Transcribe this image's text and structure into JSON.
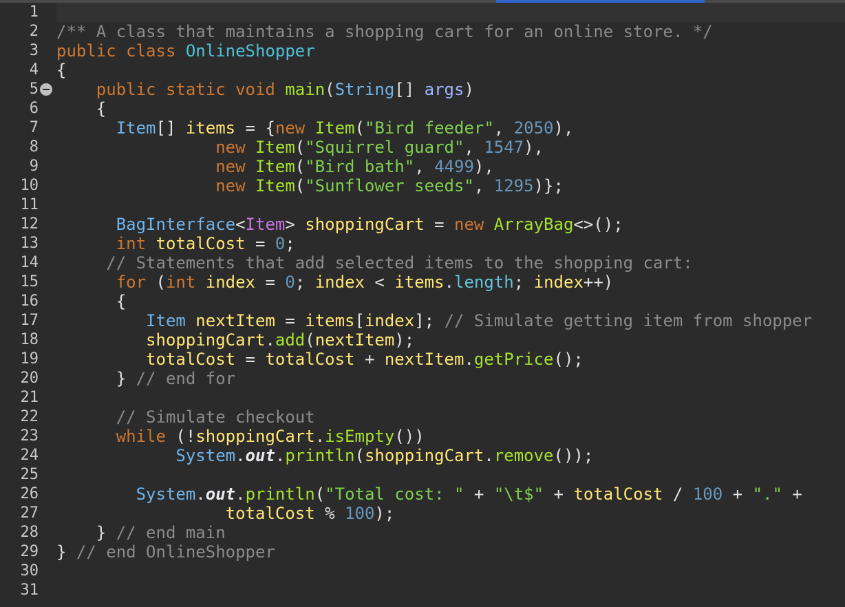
{
  "editor": {
    "line_numbers": [
      "1",
      "2",
      "3",
      "4",
      "5",
      "6",
      "7",
      "8",
      "9",
      "10",
      "11",
      "12",
      "13",
      "14",
      "15",
      "16",
      "17",
      "18",
      "19",
      "20",
      "21",
      "22",
      "23",
      "24",
      "25",
      "26",
      "27",
      "28",
      "29",
      "30",
      "31"
    ],
    "lines": [
      [],
      [
        {
          "t": "/** A class that maintains a shopping cart for an online store. */",
          "c": "cmt"
        }
      ],
      [
        {
          "t": "public class ",
          "c": "kw"
        },
        {
          "t": "OnlineShopper",
          "c": "cls"
        }
      ],
      [
        {
          "t": "{",
          "c": "plain"
        }
      ],
      [
        {
          "t": "    public static void ",
          "c": "kw"
        },
        {
          "t": "main",
          "c": "method"
        },
        {
          "t": "(",
          "c": "plain"
        },
        {
          "t": "String",
          "c": "type"
        },
        {
          "t": "[] ",
          "c": "plain"
        },
        {
          "t": "args",
          "c": "param"
        },
        {
          "t": ")",
          "c": "plain"
        }
      ],
      [
        {
          "t": "    {",
          "c": "plain"
        }
      ],
      [
        {
          "t": "      ",
          "c": "plain"
        },
        {
          "t": "Item",
          "c": "type"
        },
        {
          "t": "[] ",
          "c": "plain"
        },
        {
          "t": "items",
          "c": "var"
        },
        {
          "t": " = {",
          "c": "plain"
        },
        {
          "t": "new ",
          "c": "kw"
        },
        {
          "t": "Item",
          "c": "method"
        },
        {
          "t": "(",
          "c": "plain"
        },
        {
          "t": "\"Bird feeder\"",
          "c": "str"
        },
        {
          "t": ", ",
          "c": "plain"
        },
        {
          "t": "2050",
          "c": "num"
        },
        {
          "t": "),",
          "c": "plain"
        }
      ],
      [
        {
          "t": "                ",
          "c": "plain"
        },
        {
          "t": "new ",
          "c": "kw"
        },
        {
          "t": "Item",
          "c": "method"
        },
        {
          "t": "(",
          "c": "plain"
        },
        {
          "t": "\"Squirrel guard\"",
          "c": "str"
        },
        {
          "t": ", ",
          "c": "plain"
        },
        {
          "t": "1547",
          "c": "num"
        },
        {
          "t": "),",
          "c": "plain"
        }
      ],
      [
        {
          "t": "                ",
          "c": "plain"
        },
        {
          "t": "new ",
          "c": "kw"
        },
        {
          "t": "Item",
          "c": "method"
        },
        {
          "t": "(",
          "c": "plain"
        },
        {
          "t": "\"Bird bath\"",
          "c": "str"
        },
        {
          "t": ", ",
          "c": "plain"
        },
        {
          "t": "4499",
          "c": "num"
        },
        {
          "t": "),",
          "c": "plain"
        }
      ],
      [
        {
          "t": "                ",
          "c": "plain"
        },
        {
          "t": "new ",
          "c": "kw"
        },
        {
          "t": "Item",
          "c": "method"
        },
        {
          "t": "(",
          "c": "plain"
        },
        {
          "t": "\"Sunflower seeds\"",
          "c": "str"
        },
        {
          "t": ", ",
          "c": "plain"
        },
        {
          "t": "1295",
          "c": "num"
        },
        {
          "t": ")};",
          "c": "plain"
        }
      ],
      [],
      [
        {
          "t": "      ",
          "c": "plain"
        },
        {
          "t": "BagInterface",
          "c": "type"
        },
        {
          "t": "<",
          "c": "plain"
        },
        {
          "t": "Item",
          "c": "generic"
        },
        {
          "t": "> ",
          "c": "plain"
        },
        {
          "t": "shoppingCart",
          "c": "var"
        },
        {
          "t": " = ",
          "c": "plain"
        },
        {
          "t": "new ",
          "c": "kw"
        },
        {
          "t": "ArrayBag",
          "c": "method"
        },
        {
          "t": "<>();",
          "c": "plain"
        }
      ],
      [
        {
          "t": "      ",
          "c": "plain"
        },
        {
          "t": "int ",
          "c": "kw"
        },
        {
          "t": "totalCost",
          "c": "var"
        },
        {
          "t": " = ",
          "c": "plain"
        },
        {
          "t": "0",
          "c": "num"
        },
        {
          "t": ";",
          "c": "plain"
        }
      ],
      [
        {
          "t": "     // Statements that add selected items to the shopping cart:",
          "c": "cmt"
        }
      ],
      [
        {
          "t": "      ",
          "c": "plain"
        },
        {
          "t": "for ",
          "c": "kw"
        },
        {
          "t": "(",
          "c": "plain"
        },
        {
          "t": "int ",
          "c": "kw"
        },
        {
          "t": "index",
          "c": "var"
        },
        {
          "t": " = ",
          "c": "plain"
        },
        {
          "t": "0",
          "c": "num"
        },
        {
          "t": "; ",
          "c": "plain"
        },
        {
          "t": "index",
          "c": "var"
        },
        {
          "t": " < ",
          "c": "plain"
        },
        {
          "t": "items",
          "c": "var"
        },
        {
          "t": ".",
          "c": "plain"
        },
        {
          "t": "length",
          "c": "field"
        },
        {
          "t": "; ",
          "c": "plain"
        },
        {
          "t": "index",
          "c": "var"
        },
        {
          "t": "++)",
          "c": "plain"
        }
      ],
      [
        {
          "t": "      {",
          "c": "plain"
        }
      ],
      [
        {
          "t": "         ",
          "c": "plain"
        },
        {
          "t": "Item",
          "c": "type"
        },
        {
          "t": " ",
          "c": "plain"
        },
        {
          "t": "nextItem",
          "c": "var"
        },
        {
          "t": " = ",
          "c": "plain"
        },
        {
          "t": "items",
          "c": "var"
        },
        {
          "t": "[",
          "c": "plain"
        },
        {
          "t": "index",
          "c": "var"
        },
        {
          "t": "]; ",
          "c": "plain"
        },
        {
          "t": "// Simulate getting item from shopper",
          "c": "cmt"
        }
      ],
      [
        {
          "t": "         ",
          "c": "plain"
        },
        {
          "t": "shoppingCart",
          "c": "var"
        },
        {
          "t": ".",
          "c": "plain"
        },
        {
          "t": "add",
          "c": "method"
        },
        {
          "t": "(",
          "c": "plain"
        },
        {
          "t": "nextItem",
          "c": "var"
        },
        {
          "t": ");",
          "c": "plain"
        }
      ],
      [
        {
          "t": "         ",
          "c": "plain"
        },
        {
          "t": "totalCost",
          "c": "var"
        },
        {
          "t": " = ",
          "c": "plain"
        },
        {
          "t": "totalCost",
          "c": "var"
        },
        {
          "t": " + ",
          "c": "plain"
        },
        {
          "t": "nextItem",
          "c": "var"
        },
        {
          "t": ".",
          "c": "plain"
        },
        {
          "t": "getPrice",
          "c": "method"
        },
        {
          "t": "();",
          "c": "plain"
        }
      ],
      [
        {
          "t": "      } ",
          "c": "plain"
        },
        {
          "t": "// end for",
          "c": "cmt"
        }
      ],
      [],
      [
        {
          "t": "      // Simulate checkout",
          "c": "cmt"
        }
      ],
      [
        {
          "t": "      ",
          "c": "plain"
        },
        {
          "t": "while ",
          "c": "kw"
        },
        {
          "t": "(!",
          "c": "plain"
        },
        {
          "t": "shoppingCart",
          "c": "var"
        },
        {
          "t": ".",
          "c": "plain"
        },
        {
          "t": "isEmpty",
          "c": "method"
        },
        {
          "t": "())",
          "c": "plain"
        }
      ],
      [
        {
          "t": "            ",
          "c": "plain"
        },
        {
          "t": "System",
          "c": "type"
        },
        {
          "t": ".",
          "c": "plain"
        },
        {
          "t": "out",
          "c": "static-field"
        },
        {
          "t": ".",
          "c": "plain"
        },
        {
          "t": "println",
          "c": "method"
        },
        {
          "t": "(",
          "c": "plain"
        },
        {
          "t": "shoppingCart",
          "c": "var"
        },
        {
          "t": ".",
          "c": "plain"
        },
        {
          "t": "remove",
          "c": "method"
        },
        {
          "t": "());",
          "c": "plain"
        }
      ],
      [],
      [
        {
          "t": "        ",
          "c": "plain"
        },
        {
          "t": "System",
          "c": "type"
        },
        {
          "t": ".",
          "c": "plain"
        },
        {
          "t": "out",
          "c": "static-field"
        },
        {
          "t": ".",
          "c": "plain"
        },
        {
          "t": "println",
          "c": "method"
        },
        {
          "t": "(",
          "c": "plain"
        },
        {
          "t": "\"Total cost: \"",
          "c": "str"
        },
        {
          "t": " + ",
          "c": "plain"
        },
        {
          "t": "\"\\t$\"",
          "c": "str"
        },
        {
          "t": " + ",
          "c": "plain"
        },
        {
          "t": "totalCost",
          "c": "var"
        },
        {
          "t": " / ",
          "c": "plain"
        },
        {
          "t": "100",
          "c": "num"
        },
        {
          "t": " + ",
          "c": "plain"
        },
        {
          "t": "\".\"",
          "c": "str"
        },
        {
          "t": " +",
          "c": "plain"
        }
      ],
      [
        {
          "t": "                 ",
          "c": "plain"
        },
        {
          "t": "totalCost",
          "c": "var"
        },
        {
          "t": " % ",
          "c": "plain"
        },
        {
          "t": "100",
          "c": "num"
        },
        {
          "t": ");",
          "c": "plain"
        }
      ],
      [
        {
          "t": "    } ",
          "c": "plain"
        },
        {
          "t": "// end main",
          "c": "cmt"
        }
      ],
      [
        {
          "t": "} ",
          "c": "plain"
        },
        {
          "t": "// end OnlineShopper",
          "c": "cmt"
        }
      ],
      [],
      []
    ]
  }
}
